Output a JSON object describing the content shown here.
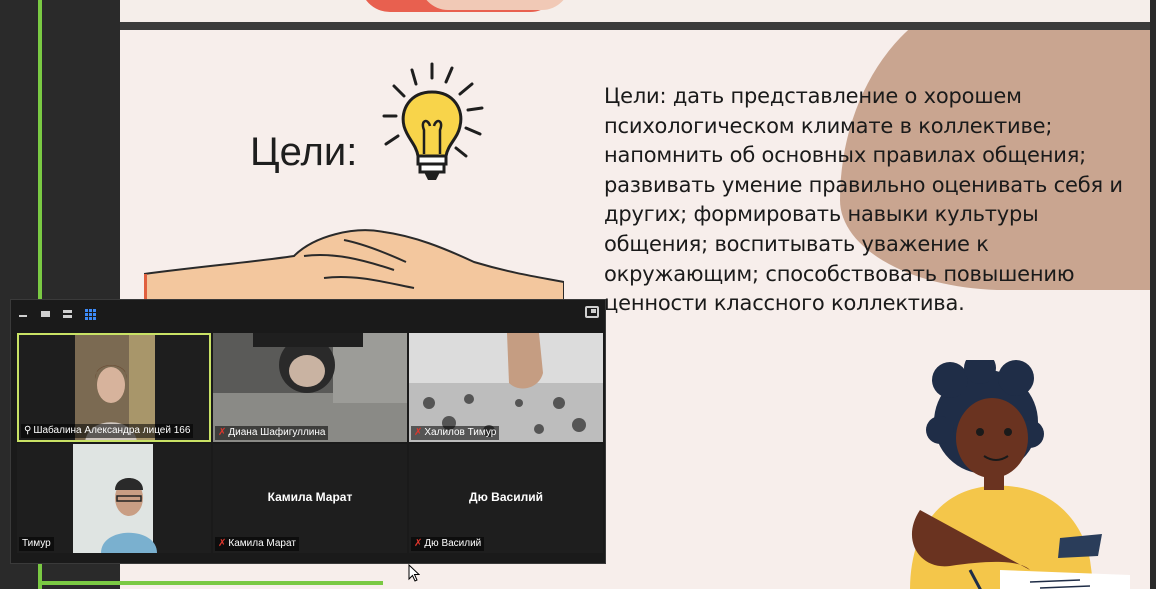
{
  "slide": {
    "title": "Цели:",
    "body": "Цели: дать  представление о хорошем психологическом климате в коллективе; напомнить об основных правилах общения; развивать умение правильно оценивать себя и других; формировать навыки культуры общения; воспитывать уважение к окружающим; способствовать повышению ценности классного коллектива."
  },
  "gallery": {
    "toolbar": {
      "minimize_icon": "minimize-icon",
      "speaker_view_icon": "speaker-view-icon",
      "strip_view_icon": "strip-view-icon",
      "gallery_view_icon": "gallery-view-icon",
      "exit_fullscreen_icon": "exit-fullscreen-icon"
    },
    "participants": [
      {
        "name": "Шабалина Александра лицей 166",
        "muted": false,
        "pinned": true,
        "video": true
      },
      {
        "name": "Диана Шафигуллина",
        "muted": true,
        "pinned": false,
        "video": true
      },
      {
        "name": "Халилов Тимур",
        "muted": true,
        "pinned": false,
        "video": true
      },
      {
        "name": "Тимур",
        "muted": false,
        "pinned": false,
        "video": true
      },
      {
        "name": "Камила Марат",
        "display_name": "Камила Марат",
        "muted": true,
        "pinned": false,
        "video": false
      },
      {
        "name": "Дю Василий",
        "display_name": "Дю Василий",
        "muted": true,
        "pinned": false,
        "video": false
      }
    ]
  },
  "colors": {
    "share_border": "#7ac943",
    "active_speaker": "#c9e265",
    "muted": "#e0362c",
    "slide_bg": "#f7eeeb",
    "slide_accent": "#c9a590"
  }
}
